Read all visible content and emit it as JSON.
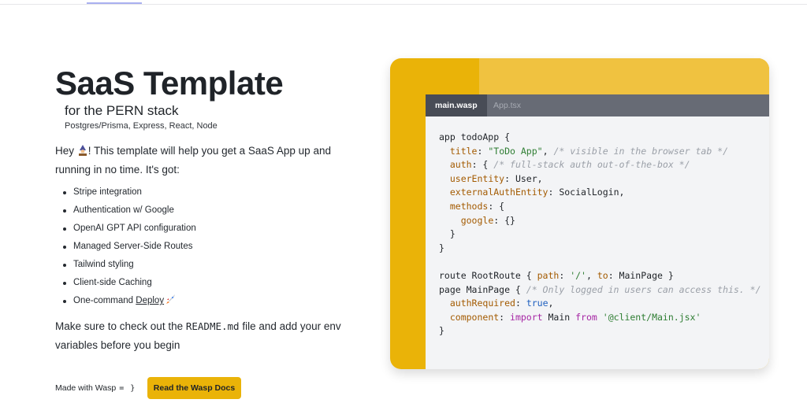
{
  "hero": {
    "title": "SaaS Template",
    "subtitle": "for the PERN stack",
    "tech": "Postgres/Prisma, Express, React, Node"
  },
  "intro": {
    "before_emoji": "Hey ",
    "emoji": "wizard-emoji",
    "after_emoji": "! This template will help you get a SaaS App up and running in no time. It's got:"
  },
  "features": [
    "Stripe integration",
    "Authentication w/ Google",
    "OpenAI GPT API configuration",
    "Managed Server-Side Routes",
    "Tailwind styling",
    "Client-side Caching"
  ],
  "deploy_item": {
    "prefix": "One-command ",
    "link": "Deploy",
    "emoji": "rocket-emoji"
  },
  "readme": {
    "before": "Make sure to check out the ",
    "file": "README.md",
    "after": " file and add your env variables before you begin"
  },
  "footer": {
    "made_with": "Made with Wasp",
    "made_with_icon": "= }",
    "docs_button": "Read the Wasp Docs"
  },
  "code_card": {
    "colors": {
      "accent": "#eab308",
      "stripe": "#f0c240",
      "tabbar": "#676b75",
      "tab_active": "#484c56"
    },
    "tabs": [
      "main.wasp",
      "App.tsx"
    ],
    "active_tab": "main.wasp",
    "lines": [
      [
        [
          "plain",
          "app todoApp {"
        ]
      ],
      [
        [
          "plain",
          "  "
        ],
        [
          "key",
          "title"
        ],
        [
          "plain",
          ": "
        ],
        [
          "str",
          "\"ToDo App\""
        ],
        [
          "plain",
          ", "
        ],
        [
          "com",
          "/* visible in the browser tab */"
        ]
      ],
      [
        [
          "plain",
          "  "
        ],
        [
          "key",
          "auth"
        ],
        [
          "plain",
          ": { "
        ],
        [
          "com",
          "/* full-stack auth out-of-the-box */"
        ]
      ],
      [
        [
          "plain",
          "  "
        ],
        [
          "key",
          "userEntity"
        ],
        [
          "plain",
          ": User,"
        ]
      ],
      [
        [
          "plain",
          "  "
        ],
        [
          "key",
          "externalAuthEntity"
        ],
        [
          "plain",
          ": SocialLogin,"
        ]
      ],
      [
        [
          "plain",
          "  "
        ],
        [
          "key",
          "methods"
        ],
        [
          "plain",
          ": {"
        ]
      ],
      [
        [
          "plain",
          "    "
        ],
        [
          "key",
          "google"
        ],
        [
          "plain",
          ": {}"
        ]
      ],
      [
        [
          "plain",
          "  }"
        ]
      ],
      [
        [
          "plain",
          "}"
        ]
      ],
      [
        [
          "plain",
          ""
        ]
      ],
      [
        [
          "plain",
          "route RootRoute { "
        ],
        [
          "key",
          "path"
        ],
        [
          "plain",
          ": "
        ],
        [
          "str",
          "'/'"
        ],
        [
          "plain",
          ", "
        ],
        [
          "key",
          "to"
        ],
        [
          "plain",
          ": MainPage }"
        ]
      ],
      [
        [
          "plain",
          "page MainPage { "
        ],
        [
          "com",
          "/* Only logged in users can access this. */"
        ]
      ],
      [
        [
          "plain",
          "  "
        ],
        [
          "key",
          "authRequired"
        ],
        [
          "plain",
          ": "
        ],
        [
          "bool",
          "true"
        ],
        [
          "plain",
          ","
        ]
      ],
      [
        [
          "plain",
          "  "
        ],
        [
          "key",
          "component"
        ],
        [
          "plain",
          ": "
        ],
        [
          "kw",
          "import"
        ],
        [
          "plain",
          " Main "
        ],
        [
          "kw",
          "from"
        ],
        [
          "plain",
          " "
        ],
        [
          "str",
          "'@client/Main.jsx'"
        ]
      ],
      [
        [
          "plain",
          "}"
        ]
      ]
    ]
  }
}
